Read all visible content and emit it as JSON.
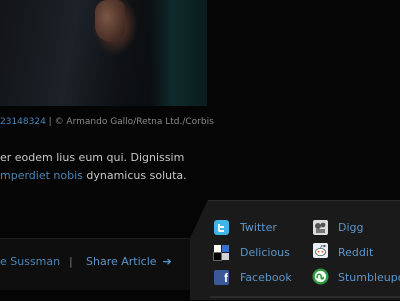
{
  "photo": {
    "credit_id": "23148324",
    "credit_text": " | © Armando Gallo/Retna Ltd./Corbis"
  },
  "article": {
    "line1": "er eodem lius eum qui. Dignissim",
    "line2_link": "mperdiet nobis",
    "line2_rest": " dynamicus soluta."
  },
  "footer": {
    "author": "e Sussman",
    "separator": "|",
    "share_label": "Share Article",
    "share_arrow": "➔"
  },
  "share_menu": {
    "items": [
      {
        "label": "Twitter",
        "icon": "twitter-icon"
      },
      {
        "label": "Digg",
        "icon": "digg-icon"
      },
      {
        "label": "Delicious",
        "icon": "delicious-icon"
      },
      {
        "label": "Reddit",
        "icon": "reddit-icon"
      },
      {
        "label": "Facebook",
        "icon": "facebook-icon"
      },
      {
        "label": "Stumbleupo",
        "icon": "stumbleupon-icon"
      }
    ]
  },
  "colors": {
    "link": "#4a86b8",
    "background": "#050505",
    "panel": "#1a1a1a"
  }
}
